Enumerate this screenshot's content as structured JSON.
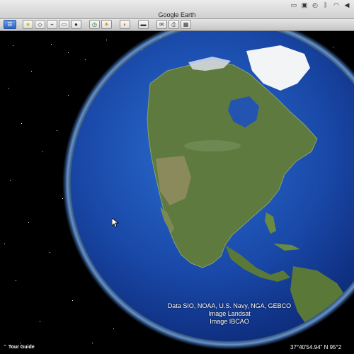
{
  "window": {
    "title": "Google Earth"
  },
  "menubar": {
    "icons": [
      "screen-mirror-icon",
      "display-icon",
      "time-machine-icon",
      "bluetooth-icon",
      "wifi-icon",
      "volume-icon"
    ]
  },
  "toolbar": {
    "buttons": [
      {
        "name": "sidebar-toggle",
        "glyph": "☰",
        "active": true
      },
      {
        "name": "add-placemark",
        "glyph": "★"
      },
      {
        "name": "add-polygon",
        "glyph": "◇"
      },
      {
        "name": "add-path",
        "glyph": "⌁"
      },
      {
        "name": "add-image-overlay",
        "glyph": "▭"
      },
      {
        "name": "record-tour",
        "glyph": "●"
      },
      {
        "name": "historical-imagery",
        "glyph": "◷"
      },
      {
        "name": "sunlight",
        "glyph": "☀"
      },
      {
        "name": "switch-to-sky",
        "glyph": "◐"
      },
      {
        "name": "ruler",
        "glyph": "▬"
      },
      {
        "name": "email",
        "glyph": "✉"
      },
      {
        "name": "print",
        "glyph": "⎙"
      },
      {
        "name": "view-in-google-maps",
        "glyph": "▦"
      }
    ]
  },
  "viewport": {
    "attribution": [
      "Data SIO, NOAA, U.S. Navy, NGA, GEBCO",
      "Image Landsat",
      "Image IBCAO"
    ],
    "tour_guide_label": "Tour Guide",
    "coordinates": "37°40'54.94\" N    95°2"
  }
}
